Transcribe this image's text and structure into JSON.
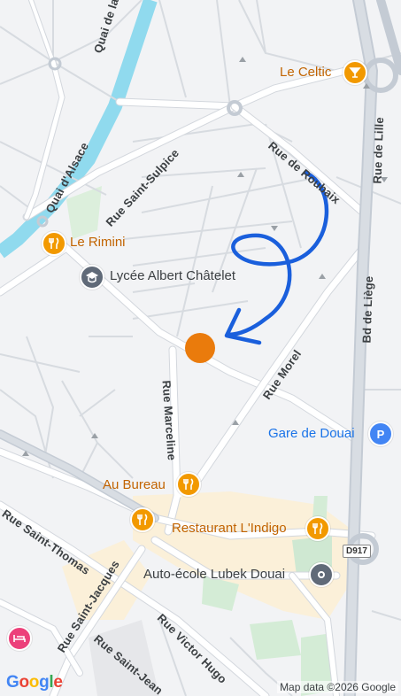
{
  "colors": {
    "background": "#f2f3f5",
    "road": "#ffffff",
    "road_outline": "#d3d7dd",
    "major_road": "#c4cbd4",
    "water": "#90daee",
    "park": "#cfe8d2",
    "commercial": "#fcefd6",
    "route_arrow": "#1a5fdc",
    "marker": "#ea7b0c",
    "food_pin": "#f29900",
    "grey_pin": "#606a78",
    "blue_pin": "#4285f4",
    "pink_pin": "#ec407a"
  },
  "streets": {
    "quai_de_la_barque": "Quai de la Barque",
    "quai_dalsace": "Quai d'Alsace",
    "rue_saint_sulpice": "Rue Saint-Sulpice",
    "rue_de_roubaix": "Rue de Roubaix",
    "rue_de_lille": "Rue de Lille",
    "bd_de_liege": "Bd de Liège",
    "rue_morel": "Rue Morel",
    "rue_marceline": "Rue Marceline",
    "rue_saint_thomas": "Rue Saint-Thomas",
    "rue_saint_jacques": "Rue Saint-Jacques",
    "rue_victor_hugo": "Rue Victor Hugo",
    "rue_saint_jean": "Rue Saint-Jean"
  },
  "pois": {
    "le_celtic": {
      "label": "Le Celtic",
      "icon": "cocktail-icon"
    },
    "le_rimini": {
      "label": "Le Rimini",
      "icon": "restaurant-icon"
    },
    "lycee": {
      "label": "Lycée Albert Châtelet",
      "icon": "school-icon"
    },
    "gare": {
      "label": "Gare de Douai",
      "icon": "parking-icon"
    },
    "au_bureau": {
      "label": "Au Bureau",
      "icon": "restaurant-icon"
    },
    "restaurant_lindigo": {
      "label": "Restaurant L'Indigo",
      "icon": "restaurant-icon"
    },
    "auto_ecole": {
      "label": "Auto-école Lubek Douai",
      "icon": "pin-icon"
    },
    "hotel": {
      "icon": "hotel-icon"
    }
  },
  "road_badge": "D917",
  "parking_symbol": "P",
  "attribution": {
    "logo": "Google",
    "map_data": "Map data ©2026 Google"
  }
}
